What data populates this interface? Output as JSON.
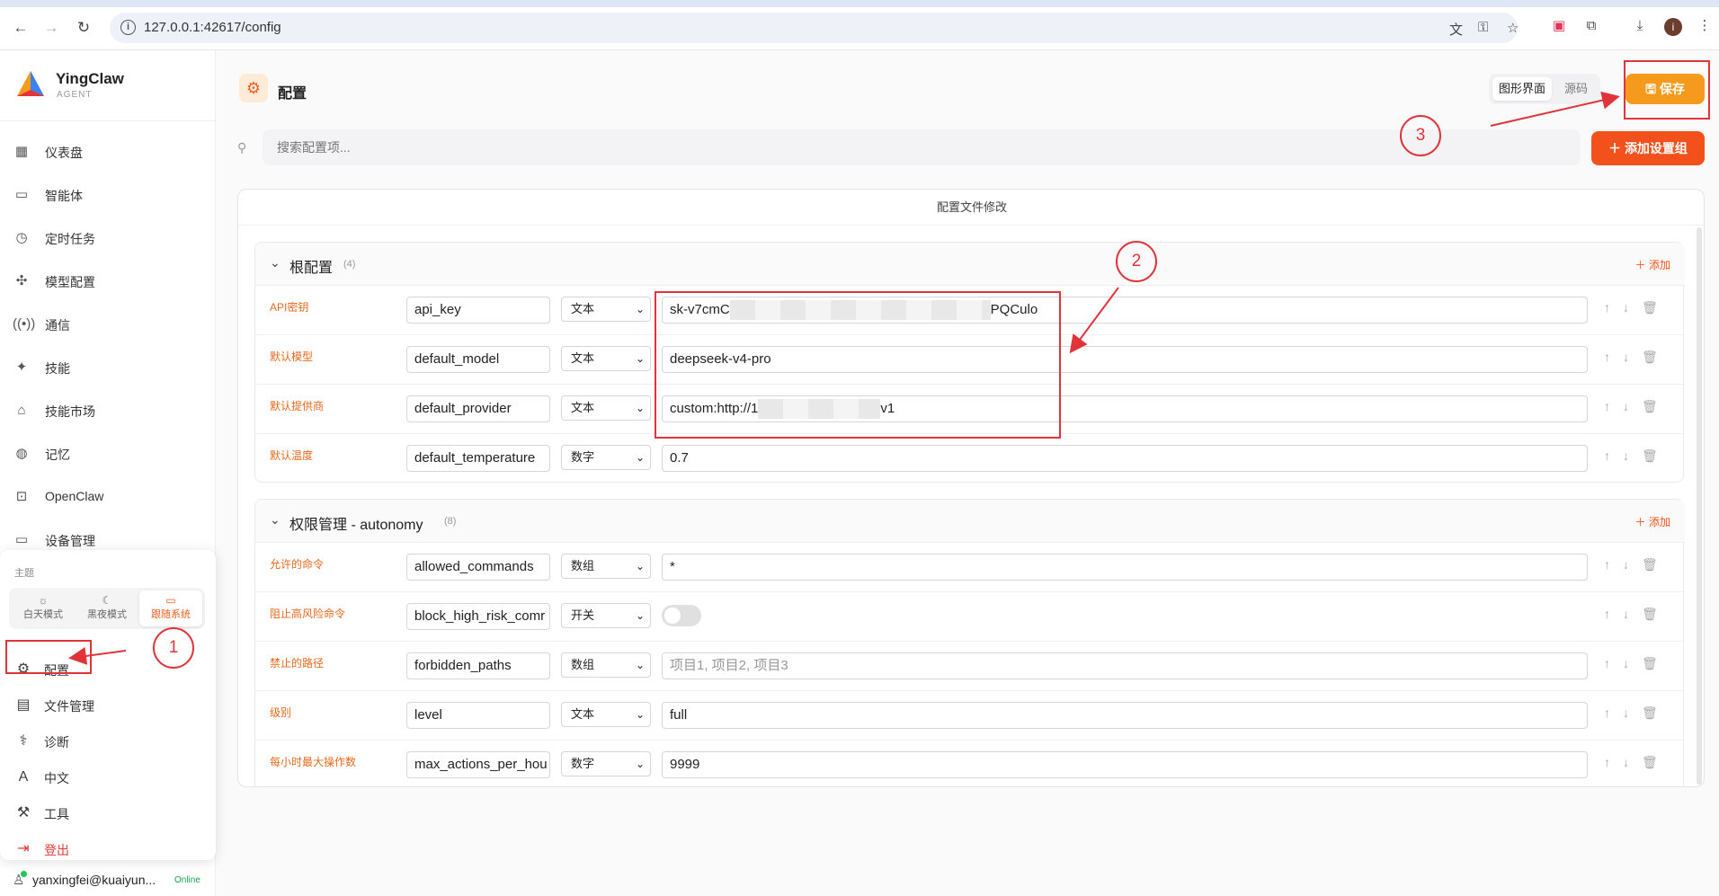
{
  "browser": {
    "url": "127.0.0.1:42617/config"
  },
  "sidebar": {
    "brand": "YingClaw",
    "brand_sub": "AGENT",
    "items": [
      {
        "label": "仪表盘",
        "icon": "dashboard-icon"
      },
      {
        "label": "智能体",
        "icon": "chat-icon"
      },
      {
        "label": "定时任务",
        "icon": "clock-icon"
      },
      {
        "label": "模型配置",
        "icon": "puzzle-icon"
      },
      {
        "label": "通信",
        "icon": "broadcast-icon"
      },
      {
        "label": "技能",
        "icon": "sparkle-icon"
      },
      {
        "label": "技能市场",
        "icon": "store-icon"
      },
      {
        "label": "记忆",
        "icon": "brain-icon"
      },
      {
        "label": "OpenClaw",
        "icon": "robot-icon"
      },
      {
        "label": "设备管理",
        "icon": "monitor-icon"
      }
    ],
    "popover": {
      "theme_title": "主题",
      "themes": [
        "白天模式",
        "黑夜模式",
        "跟随系统"
      ],
      "items": [
        {
          "label": "配置",
          "icon": "gear-icon"
        },
        {
          "label": "文件管理",
          "icon": "file-icon"
        },
        {
          "label": "诊断",
          "icon": "stethoscope-icon"
        },
        {
          "label": "中文",
          "icon": "language-icon"
        },
        {
          "label": "工具",
          "icon": "wrench-icon"
        },
        {
          "label": "登出",
          "icon": "logout-icon"
        }
      ]
    },
    "user": {
      "email": "yanxingfei@kuaiyun...",
      "status": "Online"
    }
  },
  "header": {
    "title": "配置",
    "view_tabs": [
      "图形界面",
      "源码"
    ],
    "save_label": "保存"
  },
  "search": {
    "placeholder": "搜索配置项...",
    "add_group_label": "添加设置组"
  },
  "card": {
    "title": "配置文件修改"
  },
  "sections": [
    {
      "title": "根配置",
      "count": "(4)",
      "add_label": "添加",
      "rows": [
        {
          "label": "API密钥",
          "key": "api_key",
          "type": "文本",
          "value_prefix": "sk-v7cmC",
          "value_suffix": "PQCulo"
        },
        {
          "label": "默认模型",
          "key": "default_model",
          "type": "文本",
          "value": "deepseek-v4-pro"
        },
        {
          "label": "默认提供商",
          "key": "default_provider",
          "type": "文本",
          "value_prefix": "custom:http://1",
          "value_suffix": "v1"
        },
        {
          "label": "默认温度",
          "key": "default_temperature",
          "type": "数字",
          "value": "0.7"
        }
      ]
    },
    {
      "title": "权限管理 - autonomy",
      "count": "(8)",
      "add_label": "添加",
      "rows": [
        {
          "label": "允许的命令",
          "key": "allowed_commands",
          "type": "数组",
          "value": "*"
        },
        {
          "label": "阻止高风险命令",
          "key": "block_high_risk_comr",
          "type": "开关",
          "toggle": false
        },
        {
          "label": "禁止的路径",
          "key": "forbidden_paths",
          "type": "数组",
          "placeholder": "项目1, 项目2, 项目3"
        },
        {
          "label": "级别",
          "key": "level",
          "type": "文本",
          "value": "full"
        },
        {
          "label": "每小时最大操作数",
          "key": "max_actions_per_hou",
          "type": "数字",
          "value": "9999"
        }
      ]
    }
  ],
  "annotations": [
    "1",
    "2",
    "3"
  ],
  "colors": {
    "accent": "#f3511b",
    "save": "#f59a1c",
    "annotation": "#e0343a",
    "field_label": "#e8691d"
  }
}
